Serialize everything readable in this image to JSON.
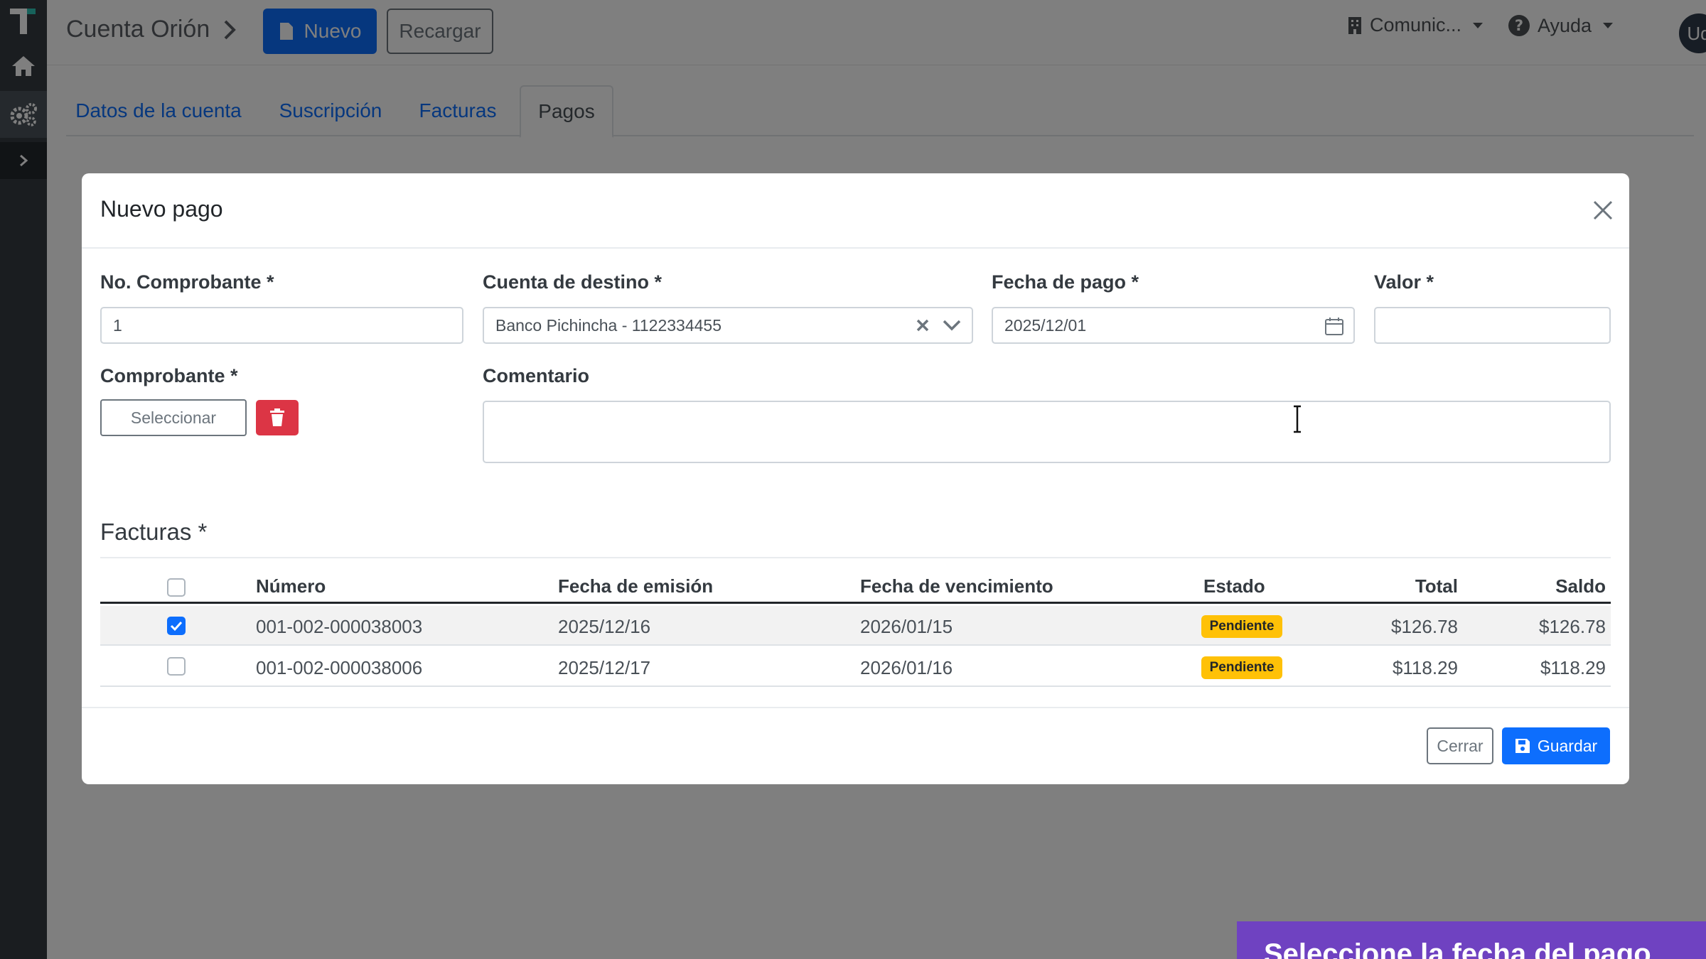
{
  "topbar": {
    "account_title": "Cuenta Orión",
    "new_label": "Nuevo",
    "reload_label": "Recargar",
    "company_label": "Comunic...",
    "help_label": "Ayuda",
    "user_initials": "Ud"
  },
  "tabs": [
    {
      "label": "Datos de la cuenta",
      "active": false
    },
    {
      "label": "Suscripción",
      "active": false
    },
    {
      "label": "Facturas",
      "active": false
    },
    {
      "label": "Pagos",
      "active": true
    }
  ],
  "modal": {
    "title": "Nuevo pago",
    "fields": {
      "receipt_no": {
        "label": "No. Comprobante *",
        "value": "1"
      },
      "destination": {
        "label": "Cuenta de destino *",
        "value": "Banco Pichincha - 1122334455"
      },
      "payment_date": {
        "label": "Fecha de pago *",
        "value": "2025/12/01"
      },
      "amount": {
        "label": "Valor *",
        "value": ""
      },
      "receipt_file": {
        "label": "Comprobante *",
        "select_label": "Seleccionar"
      },
      "comment": {
        "label": "Comentario",
        "value": ""
      }
    },
    "invoices": {
      "title": "Facturas *",
      "columns": [
        "Número",
        "Fecha de emisión",
        "Fecha de vencimiento",
        "Estado",
        "Total",
        "Saldo"
      ],
      "rows": [
        {
          "checked": true,
          "number": "001-002-000038003",
          "issue_date": "2025/12/16",
          "due_date": "2026/01/15",
          "status": "Pendiente",
          "total": "$126.78",
          "balance": "$126.78"
        },
        {
          "checked": false,
          "number": "001-002-000038006",
          "issue_date": "2025/12/17",
          "due_date": "2026/01/16",
          "status": "Pendiente",
          "total": "$118.29",
          "balance": "$118.29"
        }
      ]
    },
    "footer": {
      "close_label": "Cerrar",
      "save_label": "Guardar"
    }
  },
  "caption": "Seleccione la fecha del pago",
  "colors": {
    "primary": "#0d6efd",
    "danger": "#dc3545",
    "warning": "#ffc107",
    "sidebar": "#343a40",
    "caption": "#6f42c1"
  }
}
